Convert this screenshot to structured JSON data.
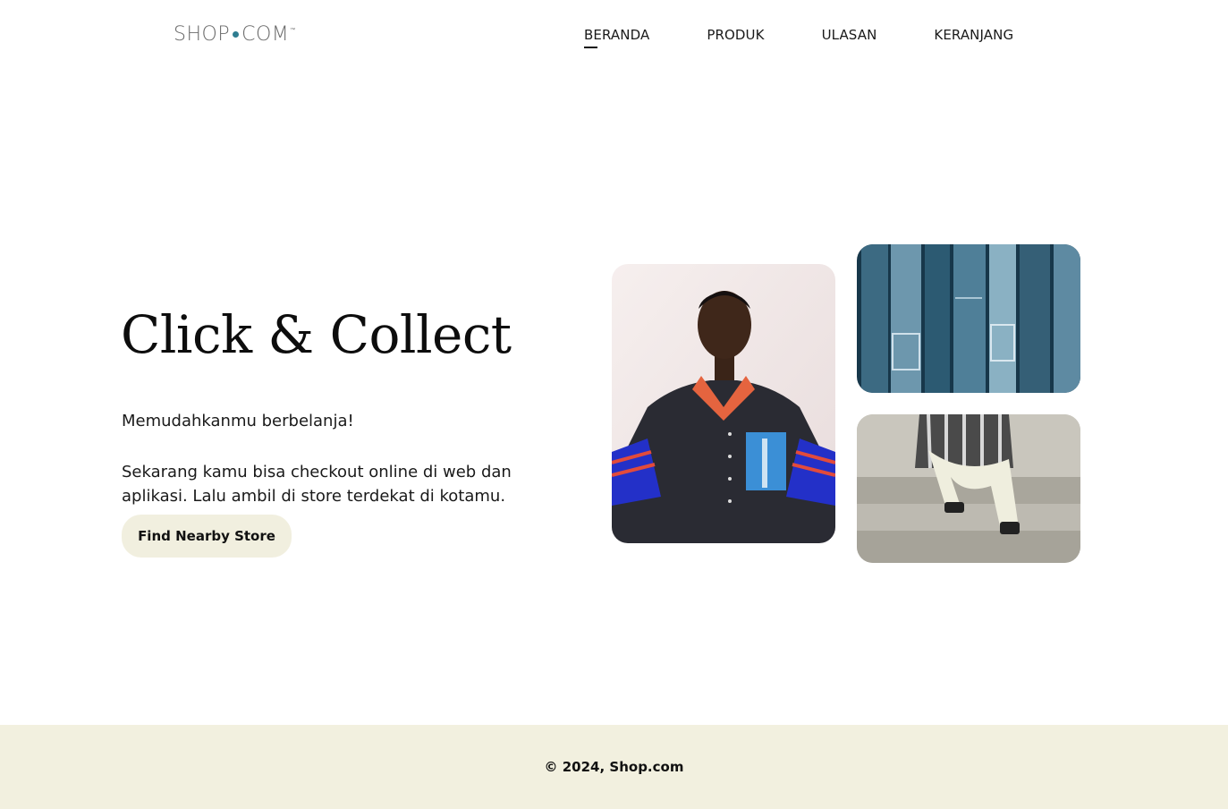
{
  "header": {
    "logo": {
      "left": "SHOP",
      "right": "COM",
      "tm": "™"
    },
    "nav": [
      {
        "label": "BERANDA",
        "active": true
      },
      {
        "label": "PRODUK",
        "active": false
      },
      {
        "label": "ULASAN",
        "active": false
      },
      {
        "label": "KERANJANG",
        "active": false
      }
    ]
  },
  "hero": {
    "title": "Click & Collect",
    "subtitle": "Memudahkanmu berbelanja!",
    "description": "Sekarang kamu bisa checkout online di web dan aplikasi. Lalu ambil di store terdekat di kotamu.",
    "cta_label": "Find Nearby Store"
  },
  "footer": {
    "copyright": "© 2024, Shop.com"
  },
  "colors": {
    "cta_bg": "#f1efdf",
    "footer_bg": "#f2f0df",
    "logo_dot": "#2e7d91"
  }
}
